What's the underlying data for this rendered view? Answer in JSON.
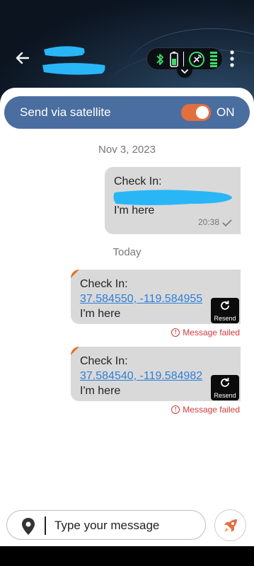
{
  "header": {
    "back_icon": "back-arrow-icon",
    "contact_name": "",
    "status_icons": [
      "bluetooth-icon",
      "battery-icon",
      "satellite-signal-icon",
      "signal-bars-icon"
    ],
    "dropdown_icon": "chevron-down-icon",
    "more_icon": "more-vertical-icon"
  },
  "satellite": {
    "label": "Send via satellite",
    "toggle_state": "ON",
    "toggle_color": "#e36f3f",
    "bar_color": "#4b6ea0"
  },
  "messages": [
    {
      "date_separator": "Nov 3, 2023"
    },
    {
      "title": "Check In:",
      "location": "",
      "body": "I'm here",
      "time": "20:38",
      "status": "sent"
    },
    {
      "date_separator": "Today"
    },
    {
      "title": "Check In:",
      "location": "37.584550, -119.584955",
      "body": "I'm here",
      "resend_label": "Resend",
      "error": "Message failed"
    },
    {
      "title": "Check In:",
      "location": "37.584540, -119.584982",
      "body": "I'm here",
      "resend_label": "Resend",
      "error": "Message failed"
    }
  ],
  "composer": {
    "placeholder": "Type your message",
    "location_icon": "map-pin-icon",
    "send_icon": "rocket-icon"
  },
  "colors": {
    "accent": "#e36f3f",
    "error": "#d23a3a",
    "link": "#2f7fd8",
    "bubble": "#d9d9d9"
  }
}
